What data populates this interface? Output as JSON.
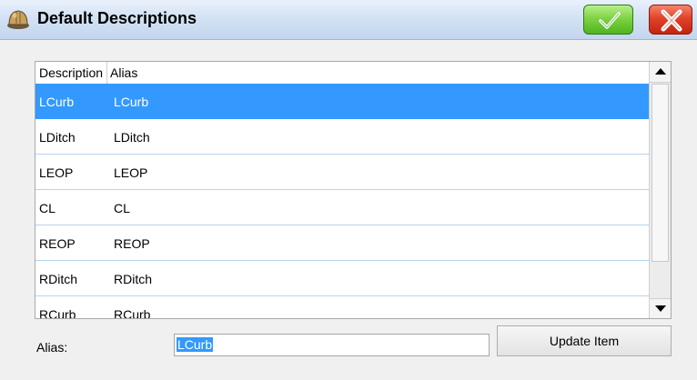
{
  "window": {
    "title": "Default Descriptions",
    "icon": "hard-hat-icon",
    "ok_icon": "checkmark-icon",
    "close_icon": "x-icon"
  },
  "grid": {
    "columns": [
      "Description",
      "Alias"
    ],
    "rows": [
      {
        "description": "LCurb",
        "alias": "LCurb",
        "selected": true
      },
      {
        "description": "LDitch",
        "alias": "LDitch"
      },
      {
        "description": "LEOP",
        "alias": "LEOP"
      },
      {
        "description": "CL",
        "alias": "CL"
      },
      {
        "description": "REOP",
        "alias": "REOP"
      },
      {
        "description": "RDitch",
        "alias": "RDitch"
      },
      {
        "description": "RCurb",
        "alias": "RCurb"
      }
    ],
    "selection_color": "#3399ff"
  },
  "form": {
    "alias_label": "Alias:",
    "alias_value": "LCurb",
    "update_label": "Update Item"
  },
  "colors": {
    "ok_green": "#6cc832",
    "close_red": "#d93a22",
    "titlebar": "#d3e2f4"
  }
}
